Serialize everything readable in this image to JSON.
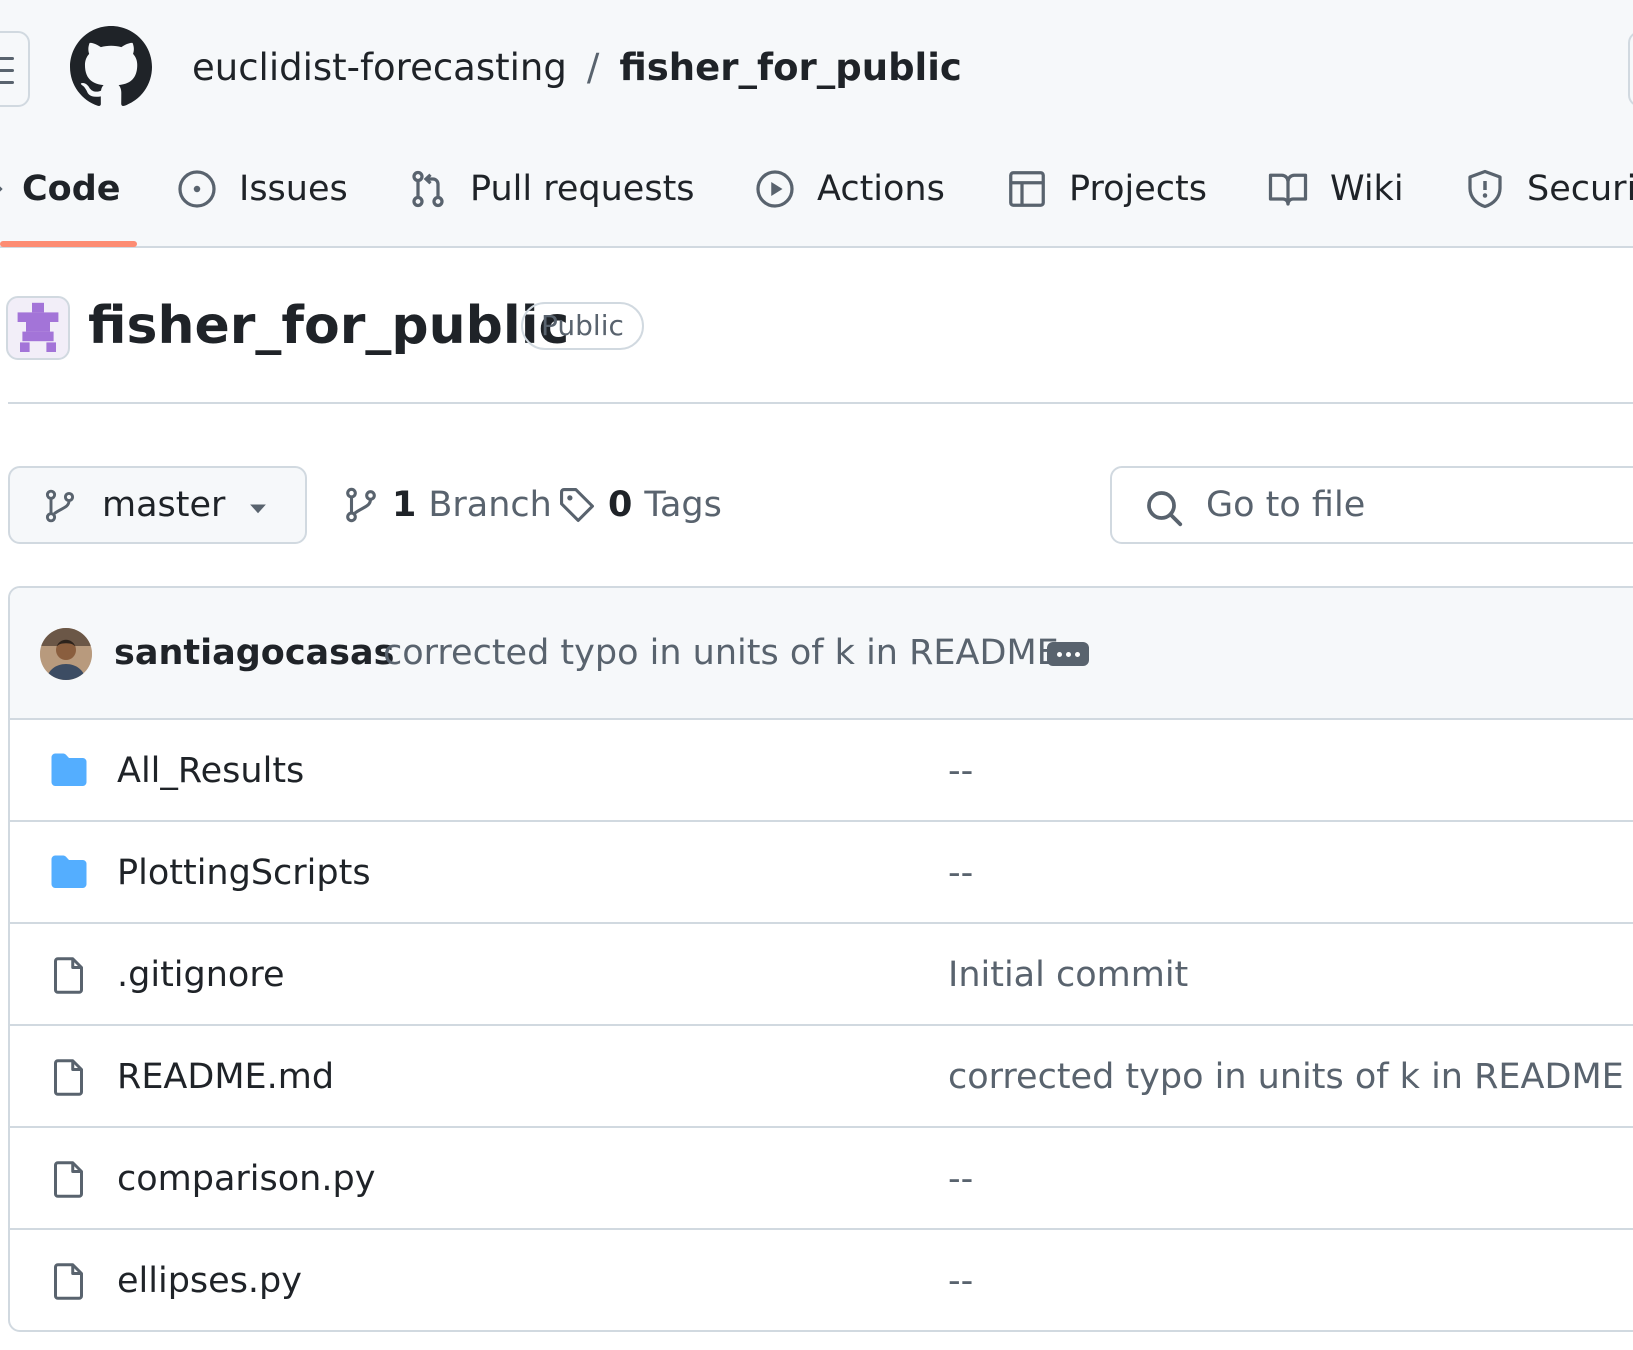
{
  "header": {
    "owner": "euclidist-forecasting",
    "separator": "/",
    "repo": "fisher_for_public"
  },
  "tabs": [
    {
      "label": "Code",
      "icon": "code-icon",
      "active": true
    },
    {
      "label": "Issues",
      "icon": "issue-opened-icon"
    },
    {
      "label": "Pull requests",
      "icon": "git-pull-request-icon"
    },
    {
      "label": "Actions",
      "icon": "play-icon"
    },
    {
      "label": "Projects",
      "icon": "table-icon"
    },
    {
      "label": "Wiki",
      "icon": "book-icon"
    },
    {
      "label": "Securi",
      "icon": "shield-icon"
    }
  ],
  "repo": {
    "title": "fisher_for_public",
    "visibility": "Public"
  },
  "branch": {
    "current": "master",
    "branch_count": "1",
    "branch_label": "Branch",
    "tag_count": "0",
    "tag_label": "Tags"
  },
  "search": {
    "placeholder": "Go to file"
  },
  "latest_commit": {
    "author": "santiagocasas",
    "message": "corrected typo in units of k in README"
  },
  "files": [
    {
      "name": "All_Results",
      "type": "folder",
      "commit": "--"
    },
    {
      "name": "PlottingScripts",
      "type": "folder",
      "commit": "--"
    },
    {
      "name": ".gitignore",
      "type": "file",
      "commit": "Initial commit"
    },
    {
      "name": "README.md",
      "type": "file",
      "commit": "corrected typo in units of k in README"
    },
    {
      "name": "comparison.py",
      "type": "file",
      "commit": "--"
    },
    {
      "name": "ellipses.py",
      "type": "file",
      "commit": "--"
    }
  ],
  "colors": {
    "accent_underline": "#fd8c73",
    "folder": "#54aeff",
    "border": "#d1d9e0",
    "muted_text": "#59636e"
  }
}
